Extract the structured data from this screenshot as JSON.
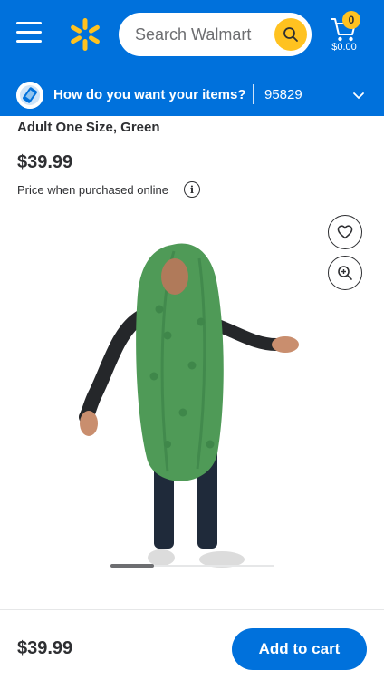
{
  "header": {
    "search_placeholder": "Search Walmart",
    "cart_count": "0",
    "cart_total": "$0.00",
    "brand_color": "#0071dc",
    "accent_color": "#ffc220"
  },
  "delivery": {
    "question": "How do you want your items?",
    "zip": "95829"
  },
  "product": {
    "variant": "Adult One Size, Green",
    "price": "$39.99",
    "price_note": "Price when purchased online",
    "info_glyph": "i",
    "image_icon": "pickle-costume-photo"
  },
  "bottom_bar": {
    "price": "$39.99",
    "add_to_cart_label": "Add to cart"
  },
  "icons": {
    "menu": "menu-icon",
    "logo": "walmart-spark-icon",
    "search": "search-icon",
    "cart": "cart-icon",
    "favorite": "heart-icon",
    "zoom": "zoom-in-icon",
    "chevron": "chevron-down-icon"
  }
}
